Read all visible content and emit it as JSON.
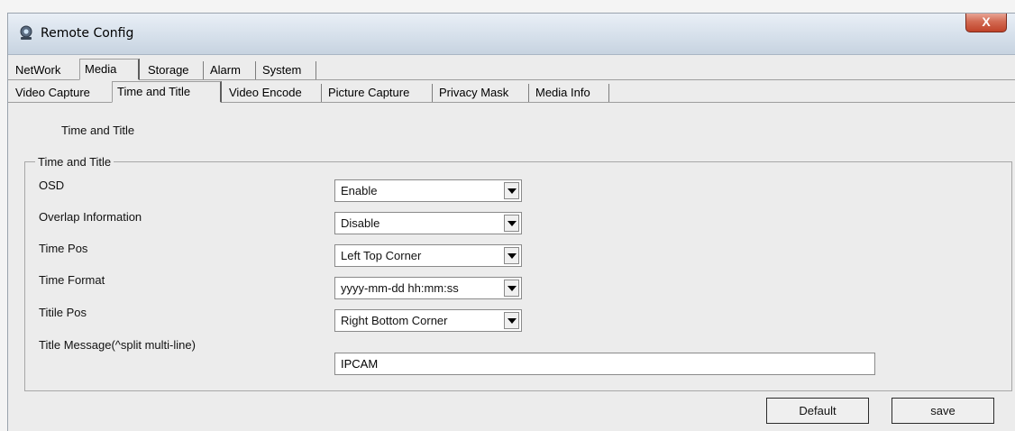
{
  "window": {
    "title": "Remote Config",
    "close_label": "X"
  },
  "top_tabs": [
    {
      "label": "NetWork",
      "active": false
    },
    {
      "label": "Media",
      "active": true
    },
    {
      "label": "Storage",
      "active": false
    },
    {
      "label": "Alarm",
      "active": false
    },
    {
      "label": "System",
      "active": false
    }
  ],
  "sub_tabs": [
    {
      "label": "Video Capture",
      "active": false
    },
    {
      "label": "Time and Title",
      "active": true
    },
    {
      "label": "Video Encode",
      "active": false
    },
    {
      "label": "Picture Capture",
      "active": false
    },
    {
      "label": "Privacy Mask",
      "active": false
    },
    {
      "label": "Media Info",
      "active": false
    }
  ],
  "section_title": "Time and Title",
  "group_title": "Time and Title",
  "fields": [
    {
      "label": "OSD",
      "value": "Enable"
    },
    {
      "label": "Overlap Information",
      "value": "Disable"
    },
    {
      "label": "Time Pos",
      "value": "Left Top Corner"
    },
    {
      "label": "Time Format",
      "value": "yyyy-mm-dd hh:mm:ss"
    },
    {
      "label": "Titile Pos",
      "value": "Right Bottom Corner"
    }
  ],
  "title_message": {
    "label": "Title Message(^split multi-line)",
    "value": "IPCAM"
  },
  "buttons": {
    "default_label": "Default",
    "save_label": "save"
  }
}
